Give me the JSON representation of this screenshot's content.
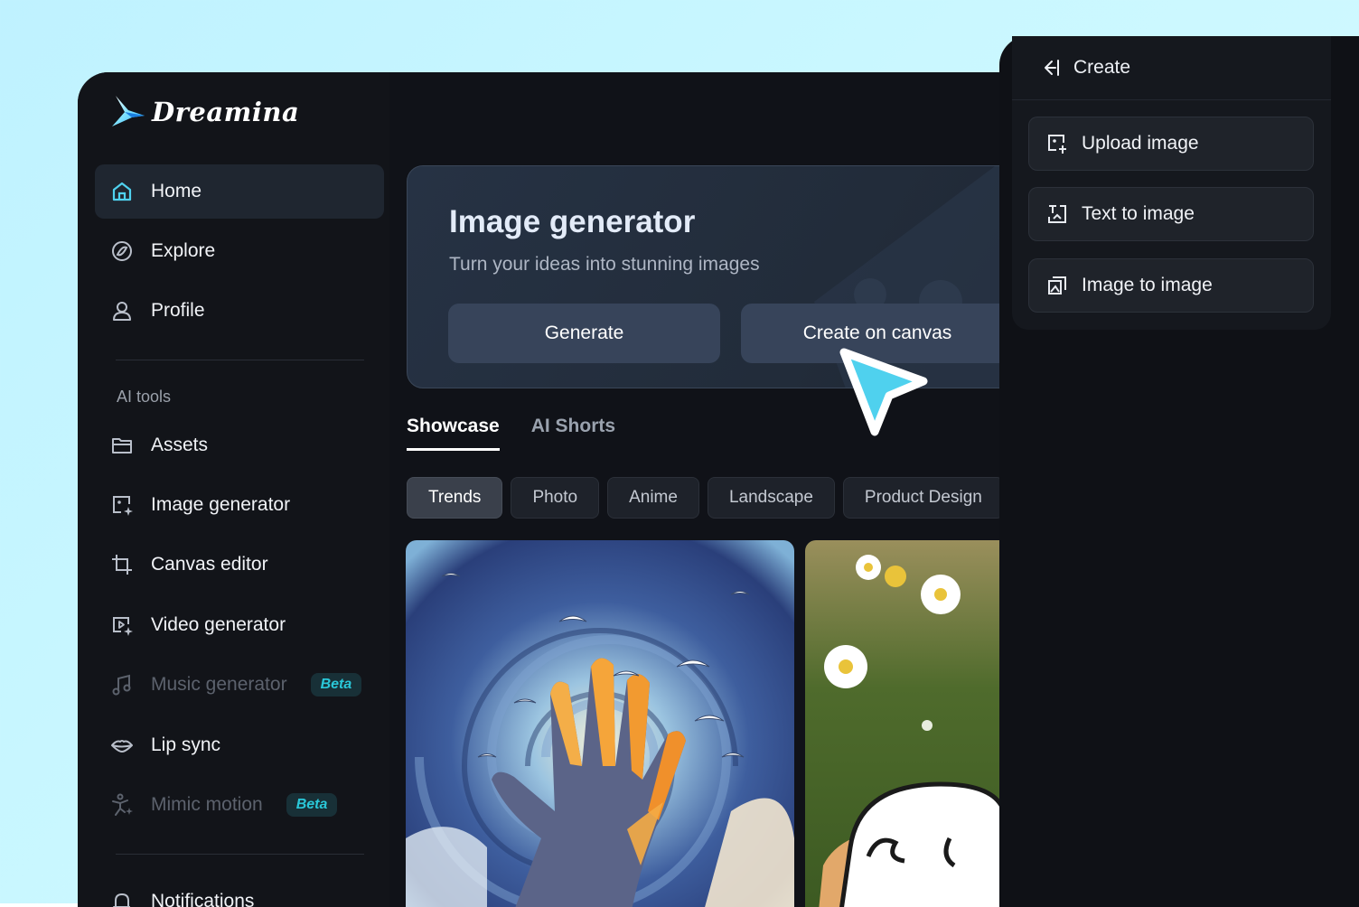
{
  "app": {
    "name": "Dreamina"
  },
  "sidebar": {
    "items": [
      {
        "label": "Home",
        "icon": "home-icon",
        "active": true
      },
      {
        "label": "Explore",
        "icon": "compass-icon"
      },
      {
        "label": "Profile",
        "icon": "user-icon"
      }
    ],
    "section_label": "AI tools",
    "tools": [
      {
        "label": "Assets",
        "icon": "folder-icon"
      },
      {
        "label": "Image generator",
        "icon": "image-sparkle-icon"
      },
      {
        "label": "Canvas editor",
        "icon": "crop-icon"
      },
      {
        "label": "Video generator",
        "icon": "video-sparkle-icon"
      },
      {
        "label": "Music generator",
        "icon": "music-note-icon",
        "badge": "Beta",
        "disabled": true
      },
      {
        "label": "Lip sync",
        "icon": "lips-icon"
      },
      {
        "label": "Mimic motion",
        "icon": "figure-motion-icon",
        "badge": "Beta",
        "disabled": true
      }
    ],
    "bottom_items": [
      {
        "label": "Notifications",
        "icon": "bell-icon"
      }
    ]
  },
  "hero": {
    "title": "Image generator",
    "subtitle": "Turn your ideas into stunning images",
    "generate_label": "Generate",
    "canvas_label": "Create on canvas"
  },
  "tabs": [
    {
      "label": "Showcase",
      "active": true
    },
    {
      "label": "AI Shorts"
    }
  ],
  "chips": [
    {
      "label": "Trends",
      "active": true
    },
    {
      "label": "Photo"
    },
    {
      "label": "Anime"
    },
    {
      "label": "Landscape"
    },
    {
      "label": "Product Design"
    }
  ],
  "create_panel": {
    "title": "Create",
    "items": [
      {
        "label": "Upload image",
        "icon": "upload-image-icon"
      },
      {
        "label": "Text to image",
        "icon": "text-to-image-icon"
      },
      {
        "label": "Image to image",
        "icon": "image-to-image-icon"
      }
    ]
  },
  "colors": {
    "accent": "#4fd1ee",
    "beta_badge": "#2ac7d8",
    "window_bg": "#101218",
    "hero_button": "#37445a"
  }
}
